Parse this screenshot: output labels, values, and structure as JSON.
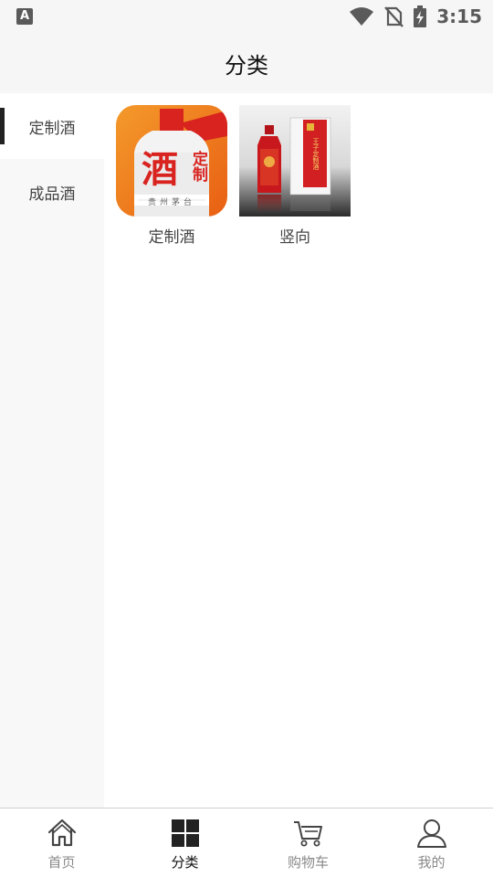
{
  "status_bar": {
    "left_icon": "A",
    "time": "3:15",
    "icons": [
      "wifi-icon",
      "no-sim-icon",
      "battery-charging-icon"
    ]
  },
  "header": {
    "title": "分类"
  },
  "sidebar": {
    "items": [
      {
        "label": "定制酒",
        "active": true
      },
      {
        "label": "成品酒",
        "active": false
      }
    ]
  },
  "products": [
    {
      "label": "定制酒",
      "thumb_text_main": "酒",
      "thumb_text_side": "定制",
      "thumb_text_bottom": "贵州茅台"
    },
    {
      "label": "竖向",
      "thumb_text_box": "王子定制酒"
    }
  ],
  "bottom_nav": {
    "items": [
      {
        "label": "首页",
        "icon": "home-icon",
        "active": false
      },
      {
        "label": "分类",
        "icon": "grid-icon",
        "active": true
      },
      {
        "label": "购物车",
        "icon": "cart-icon",
        "active": false
      },
      {
        "label": "我的",
        "icon": "user-icon",
        "active": false
      }
    ]
  },
  "colors": {
    "accent": "#111111",
    "inactive": "#8a8a8a",
    "sidebar_bg": "#f8f8f8",
    "brand_red": "#d8231f",
    "brand_orange": "#f07a1a"
  }
}
